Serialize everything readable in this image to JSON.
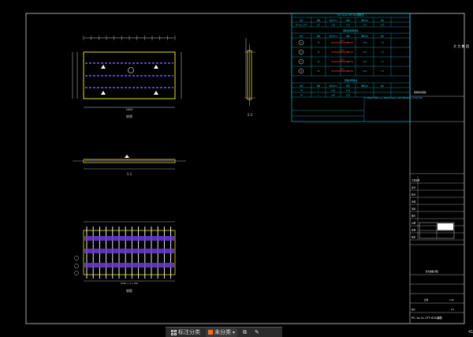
{
  "drawing": {
    "frame_colors": {
      "outer": "#cccccc",
      "cyan": "#19d3e6",
      "yellow": "#e8e000",
      "purple": "#7a55ff",
      "white": "#ffffff",
      "red": "#ff3030",
      "green": "#33dd33"
    },
    "top_view_label": "俯视",
    "side_view_label": "2-2",
    "section_label": "1-1",
    "rebar_view_label": "钢筋",
    "dim_top_width": "2640",
    "dim_rebar_width": "2640 x 2 x 350",
    "table_title_1": "PC-1a-1L-2TF-63L钢筋表",
    "table_title_2": "钢筋材料明细表",
    "table_title_3": "预埋件明细表",
    "table_headers": [
      "编号",
      "规格",
      "长度(mm)",
      "数量",
      "重量(kg)",
      "备注"
    ],
    "table_row_1": [
      "PC-1a-1L-2TF",
      "C8",
      "1.00",
      "2.70",
      "3.42",
      "2.43"
    ],
    "table_rows_2": [
      [
        "1",
        "C8",
        "3430",
        "1",
        "2.43",
        "1.8"
      ],
      [
        "2",
        "C8",
        "3430",
        "2",
        "2.43",
        "1.8"
      ],
      [
        "3",
        "C8",
        "3430",
        "6",
        "2.43",
        "1.5"
      ],
      [
        "4",
        "C8",
        "3430",
        "4",
        "2.43",
        "1.8"
      ]
    ],
    "table_rows_3": [
      [
        "MJ",
        "1",
        "0.80",
        "6.38",
        "",
        ""
      ],
      [
        "DT",
        "1",
        "0.80",
        "6.38",
        "",
        ""
      ]
    ],
    "table_note": "注: 钢筋保护层厚度15mm, 钢筋等级HRB400, 混凝土强度等级C30, 详见设计说明",
    "title_company": "大 力 集 团",
    "title_note": "预制叠合楼板",
    "title_block_rows": [
      "工程名称",
      "设计",
      "校对",
      "审核",
      "审定",
      "图号",
      "日期",
      "比例",
      "版本"
    ],
    "title_drawing_name": "叠合楼板详图",
    "title_drawing_code": "PC-1a-1L-2TF-63L钢筋",
    "title_scale_label": "比例",
    "title_scale_value": "1:25",
    "title_sheet_label": "图号",
    "title_sheet_value": "2/4",
    "corner_label": "41"
  },
  "statusbar": {
    "btn_annotation": "标注分类",
    "btn_unclassified": "未分类",
    "grid_icon_color": "#dddddd",
    "unclassified_color": "#ff6a1a"
  }
}
